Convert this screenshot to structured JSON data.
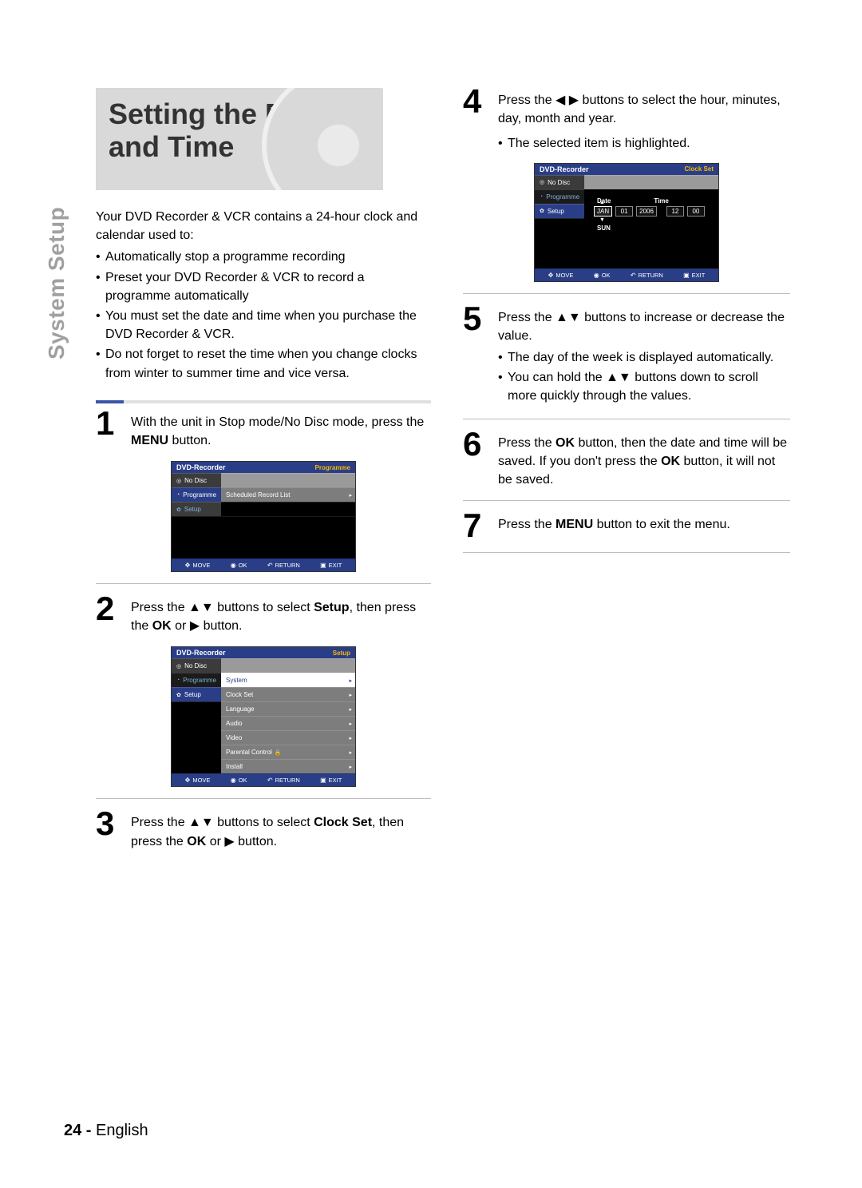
{
  "side_tab": "System Setup",
  "title": "Setting the Date and Time",
  "intro_lead": "Your DVD Recorder & VCR contains a 24-hour clock and calendar used to:",
  "intro_bullets": [
    "Automatically stop a programme recording",
    "Preset your DVD Recorder & VCR to record a programme automatically",
    "You must set the date and time when you purchase the DVD Recorder & VCR.",
    "Do not forget to reset the time when you change clocks from winter to summer time and vice versa."
  ],
  "steps": {
    "s1": {
      "num": "1",
      "pre": "With the unit in Stop mode/No Disc mode, press the ",
      "b1": "MENU",
      "post": " button."
    },
    "s2": {
      "num": "2",
      "a": "Press the ",
      "b": "▲▼",
      "c": " buttons to select ",
      "d": "Setup",
      "e": ", then press the ",
      "f": "OK",
      "g": " or ",
      "h": "▶",
      "i": " button."
    },
    "s3": {
      "num": "3",
      "a": "Press the ",
      "b": "▲▼",
      "c": " buttons to select ",
      "d": "Clock Set",
      "e": ", then press the ",
      "f": "OK",
      "g": " or ",
      "h": "▶",
      "i": " button."
    },
    "s4": {
      "num": "4",
      "a": "Press the ",
      "b": "◀ ▶",
      "c": " buttons to select the hour, minutes, day, month and year.",
      "bullet": "The selected item is highlighted."
    },
    "s5": {
      "num": "5",
      "a": "Press the ",
      "b": "▲▼",
      "c": " buttons to increase or decrease the value.",
      "bullets": [
        "The day of the week is displayed automatically.",
        "You can hold the ▲▼ buttons down to scroll more quickly through the values."
      ]
    },
    "s6": {
      "num": "6",
      "a": "Press the ",
      "b": "OK",
      "c": " button, then the date and time will be saved. If you don't press the ",
      "d": "OK",
      "e": " button, it will not be saved."
    },
    "s7": {
      "num": "7",
      "a": "Press the ",
      "b": "MENU",
      "c": " button to exit the menu."
    }
  },
  "osd_common": {
    "title": "DVD-Recorder",
    "no_disc": "No Disc",
    "programme": "Programme",
    "setup": "Setup",
    "footer": {
      "move": "MOVE",
      "ok": "OK",
      "return": "RETURN",
      "exit": "EXIT"
    }
  },
  "osd1": {
    "hdr_right": "Programme",
    "main_row": "Scheduled Record List"
  },
  "osd2": {
    "hdr_right": "Setup",
    "menu": [
      "System",
      "Clock Set",
      "Language",
      "Audio",
      "Video",
      "Parental Control",
      "Install"
    ]
  },
  "osd3": {
    "hdr_right": "Clock Set",
    "labels": {
      "date": "Date",
      "time": "Time"
    },
    "fields": {
      "mon": "JAN",
      "day": "01",
      "year": "2006",
      "hr": "12",
      "min": "00"
    },
    "dow": "SUN"
  },
  "page_footer": {
    "num": "24 -",
    "lang": "English"
  }
}
